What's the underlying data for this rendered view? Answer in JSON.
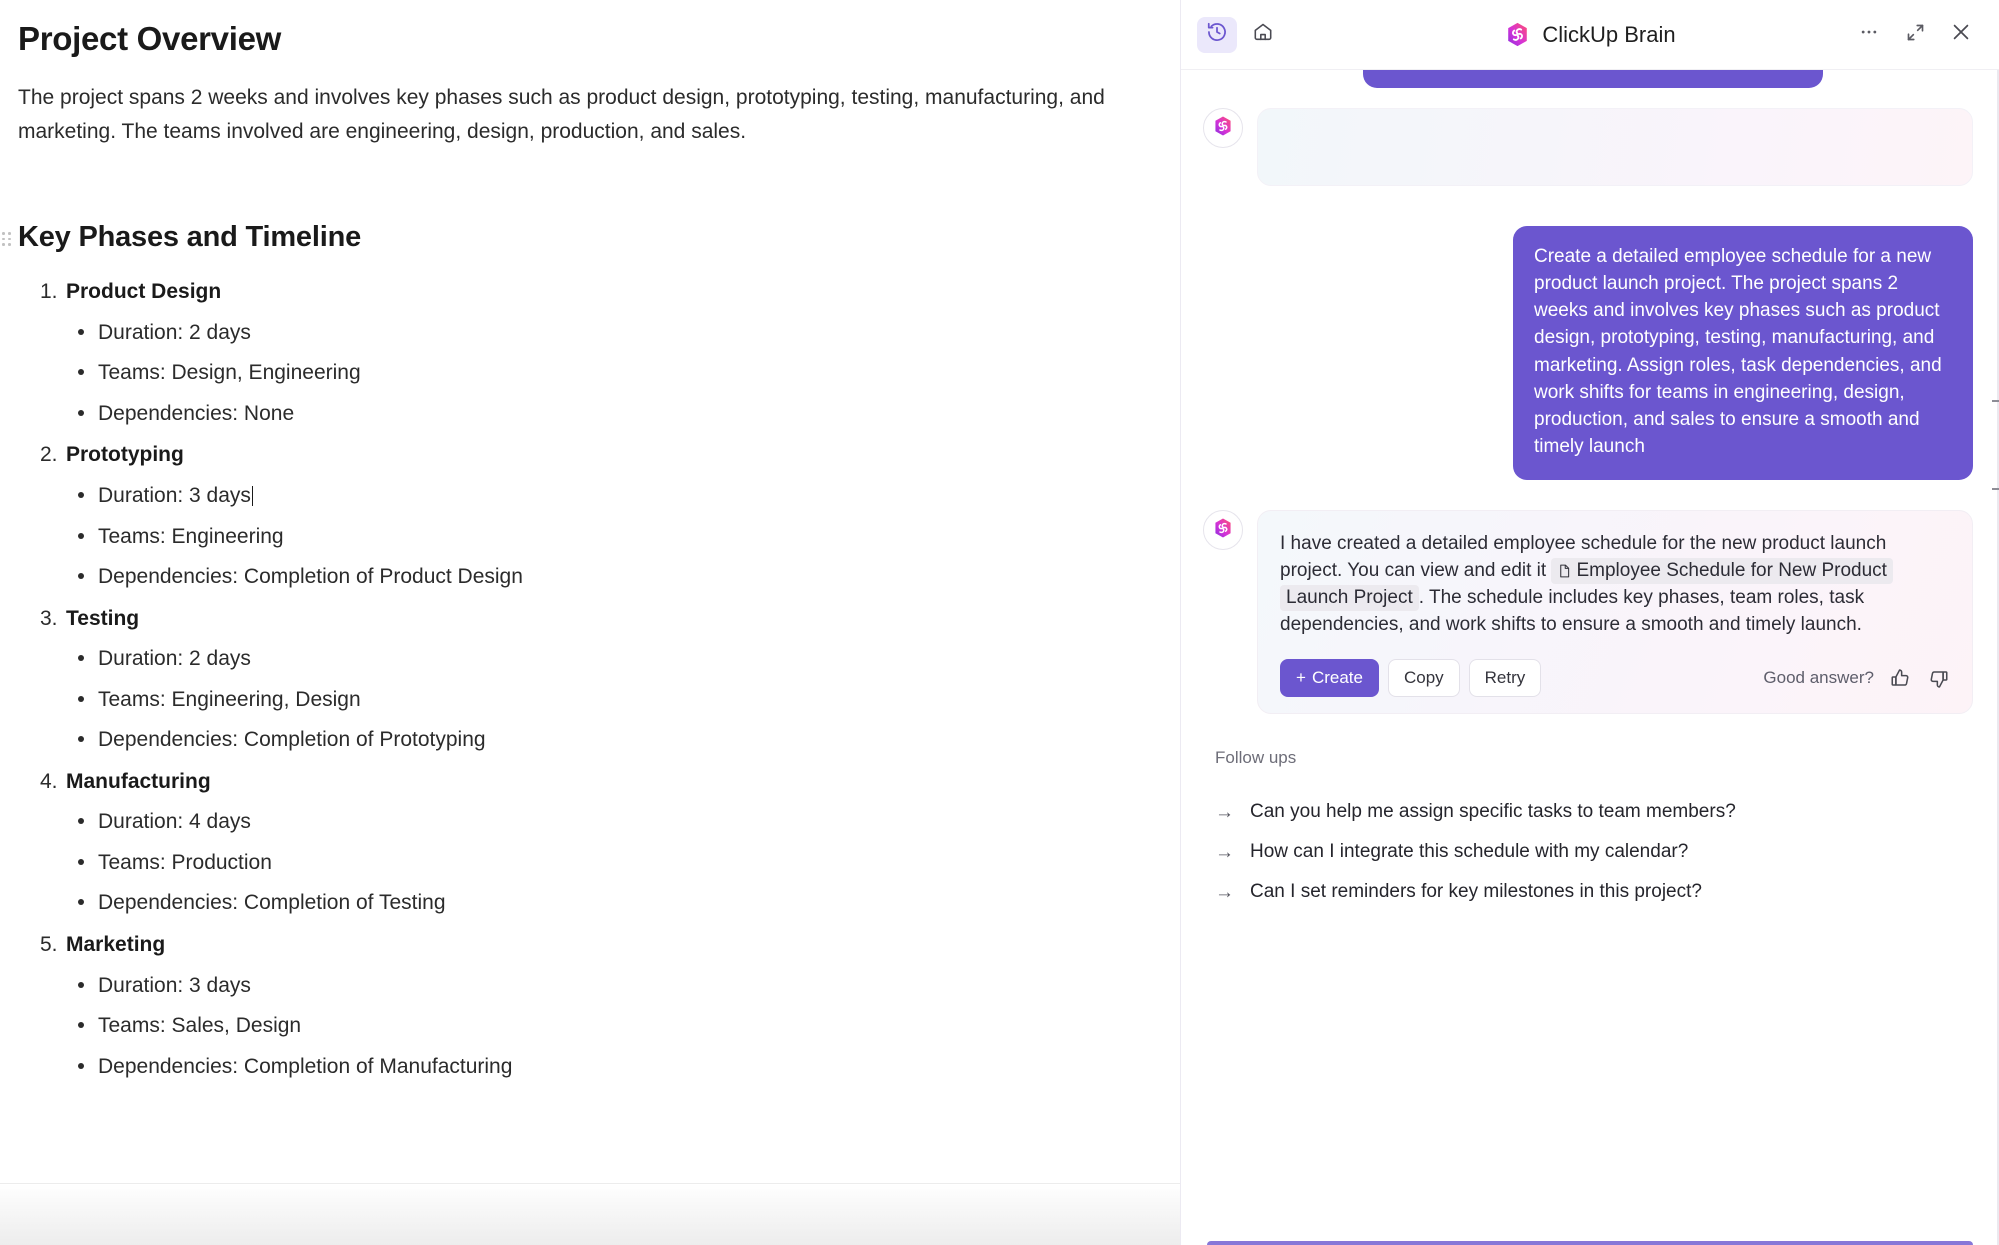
{
  "document": {
    "title": "Project Overview",
    "overview_paragraph": "The project spans 2 weeks and involves key phases such as product design, prototyping, testing, manufacturing, and marketing. The teams involved are engineering, design, production, and sales.",
    "section_title": "Key Phases and Timeline",
    "phases": [
      {
        "number": "1.",
        "name": "Product Design",
        "details": [
          "Duration: 2 days",
          "Teams: Design, Engineering",
          "Dependencies: None"
        ]
      },
      {
        "number": "2.",
        "name": "Prototyping",
        "details": [
          "Duration: 3 days",
          "Teams: Engineering",
          "Dependencies: Completion of Product Design"
        ]
      },
      {
        "number": "3.",
        "name": "Testing",
        "details": [
          "Duration: 2 days",
          "Teams: Engineering, Design",
          "Dependencies: Completion of Prototyping"
        ]
      },
      {
        "number": "4.",
        "name": "Manufacturing",
        "details": [
          "Duration: 4 days",
          "Teams: Production",
          "Dependencies: Completion of Testing"
        ]
      },
      {
        "number": "5.",
        "name": "Marketing",
        "details": [
          "Duration: 3 days",
          "Teams: Sales, Design",
          "Dependencies: Completion of Manufacturing"
        ]
      }
    ]
  },
  "brain_panel": {
    "title": "ClickUp Brain",
    "header_icons": {
      "history": "history-clock-icon",
      "home": "home-icon",
      "more": "more-options-icon",
      "expand": "expand-icon",
      "close": "close-icon"
    },
    "conversation": {
      "user_message": "Create a detailed employee schedule for a new product launch project. The project spans 2 weeks and involves key phases such as product design, prototyping, testing, manufacturing, and marketing. Assign roles, task dependencies, and work shifts for teams in engineering, design, production, and sales to ensure a smooth and timely launch",
      "assistant_message_prefix": "I have created a detailed employee schedule for the new product launch project. You can view and edit it ",
      "assistant_doc_link": "Employee Schedule for New Product Launch Project",
      "assistant_message_suffix": ". The schedule includes key phases, team roles, task dependencies, and work shifts to ensure a smooth and timely launch."
    },
    "actions": {
      "create_label": "Create",
      "create_plus": "+",
      "copy_label": "Copy",
      "retry_label": "Retry",
      "feedback_label": "Good answer?",
      "thumbs_up": "thumbs-up-icon",
      "thumbs_down": "thumbs-down-icon"
    },
    "followups": {
      "title": "Follow ups",
      "arrow": "→",
      "items": [
        "Can you help me assign specific tasks to team members?",
        "How can I integrate this schedule with my calendar?",
        "Can I set reminders for key milestones in this project?"
      ]
    }
  },
  "colors": {
    "brand_purple": "#6b56cf",
    "accent_light": "#ebe8fb",
    "text_primary": "#1a1a1a",
    "chip_bg": "#eceaef"
  }
}
